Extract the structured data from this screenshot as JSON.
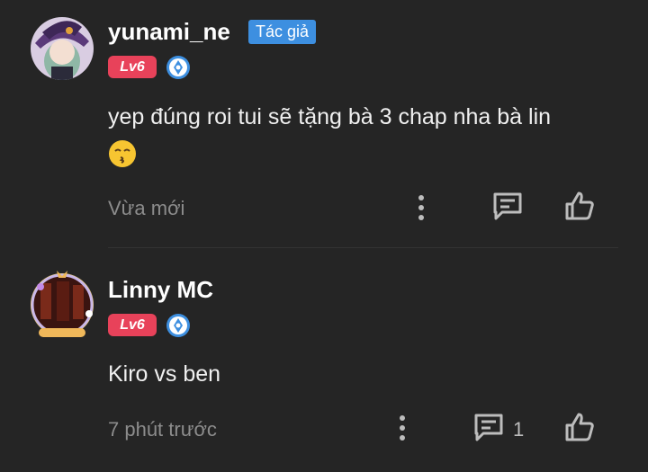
{
  "comments": [
    {
      "username": "yunami_ne",
      "author_badge": "Tác giả",
      "level": "Lv6",
      "text": "yep đúng roi tui sẽ tặng bà 3 chap nha bà lin",
      "emoji": "kissing-face",
      "time": "Vừa mới",
      "reply_count": ""
    },
    {
      "username": "Linny MC",
      "level": "Lv6",
      "text": "Kiro vs ben",
      "time": "7 phút trước",
      "reply_count": "1"
    }
  ],
  "colors": {
    "background": "#252525",
    "level_badge": "#e8425a",
    "author_badge": "#3d8fe0",
    "muted_text": "#8c8c8c"
  }
}
